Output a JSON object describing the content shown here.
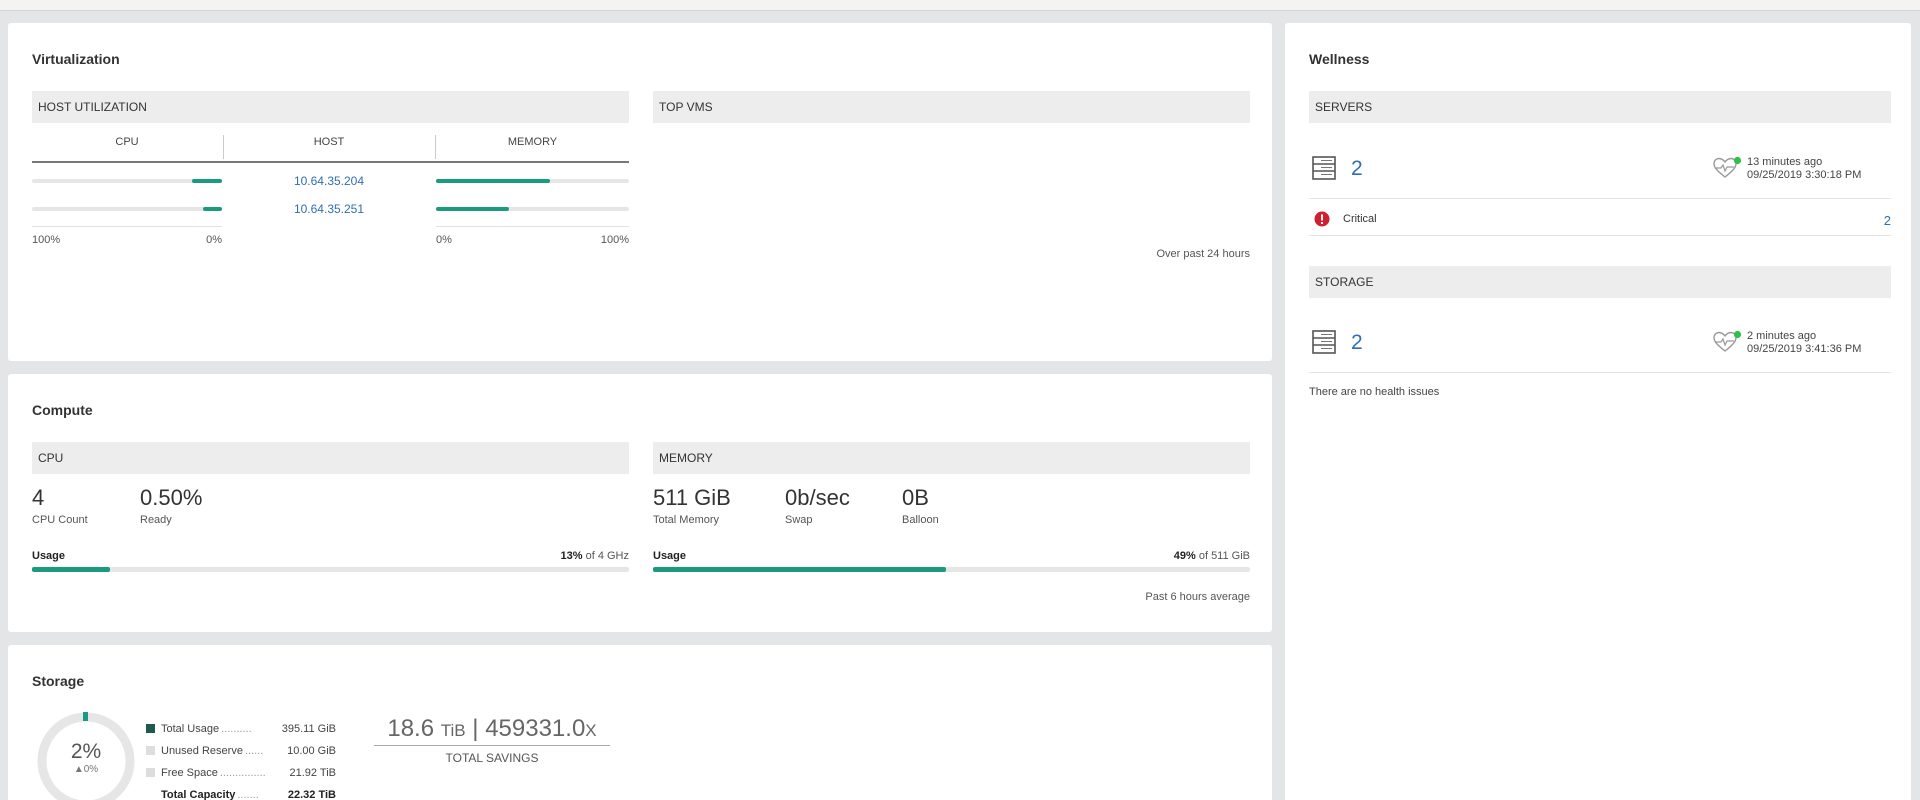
{
  "virtualization": {
    "title": "Virtualization",
    "host_util": {
      "header": "HOST UTILIZATION",
      "col_cpu": "CPU",
      "col_host": "HOST",
      "col_memory": "MEMORY",
      "rows": [
        {
          "host": "10.64.35.204",
          "cpu_pct": 16,
          "mem_pct": 59
        },
        {
          "host": "10.64.35.251",
          "cpu_pct": 10,
          "mem_pct": 38
        }
      ],
      "cpu_axis_left": "100%",
      "cpu_axis_right": "0%",
      "mem_axis_left": "0%",
      "mem_axis_right": "100%"
    },
    "top_vms": {
      "header": "TOP VMS",
      "footnote": "Over past 24 hours"
    }
  },
  "compute": {
    "title": "Compute",
    "cpu": {
      "header": "CPU",
      "count_value": "4",
      "count_label": "CPU Count",
      "ready_value": "0.50%",
      "ready_label": "Ready",
      "usage_label": "Usage",
      "usage_pct_text": "13%",
      "usage_of_text": " of 4 GHz",
      "usage_fraction": 0.13
    },
    "memory": {
      "header": "MEMORY",
      "total_value": "511 GiB",
      "total_label": "Total Memory",
      "swap_value": "0b/sec",
      "swap_label": "Swap",
      "balloon_value": "0B",
      "balloon_label": "Balloon",
      "usage_label": "Usage",
      "usage_pct_text": "49%",
      "usage_of_text": " of 511 GiB",
      "usage_fraction": 0.49
    },
    "footnote": "Past 6 hours average"
  },
  "storage": {
    "title": "Storage",
    "donut_pct": "2%",
    "donut_delta": "▲0%",
    "legend": [
      {
        "label": "Total Usage",
        "dots": "..........",
        "value": "395.11 GiB",
        "color": "#1f5a50"
      },
      {
        "label": "Unused Reserve",
        "dots": "......",
        "value": "10.00 GiB",
        "color": "#dddddd"
      },
      {
        "label": "Free Space",
        "dots": "...............",
        "value": "21.92 TiB",
        "color": "#dddddd"
      }
    ],
    "total_capacity_label": "Total Capacity",
    "total_capacity_dots": ".......",
    "total_capacity_value": "22.32 TiB",
    "savings_value": "18.6",
    "savings_unit": "TiB",
    "savings_sep": "|",
    "savings_ratio": "459331.0",
    "savings_ratio_unit": "X",
    "savings_label": "TOTAL SAVINGS"
  },
  "wellness": {
    "title": "Wellness",
    "servers": {
      "header": "SERVERS",
      "count": "2",
      "time_ago": "13 minutes ago",
      "timestamp": "09/25/2019 3:30:18 PM",
      "critical_label": "Critical",
      "critical_count": "2"
    },
    "storage": {
      "header": "STORAGE",
      "count": "2",
      "time_ago": "2 minutes ago",
      "timestamp": "09/25/2019 3:41:36 PM",
      "no_issues": "There are no health issues"
    }
  },
  "colors": {
    "accent": "#1a9b80",
    "link": "#2f6fb0",
    "critical": "#d0202e",
    "ok": "#2fbf4a"
  }
}
